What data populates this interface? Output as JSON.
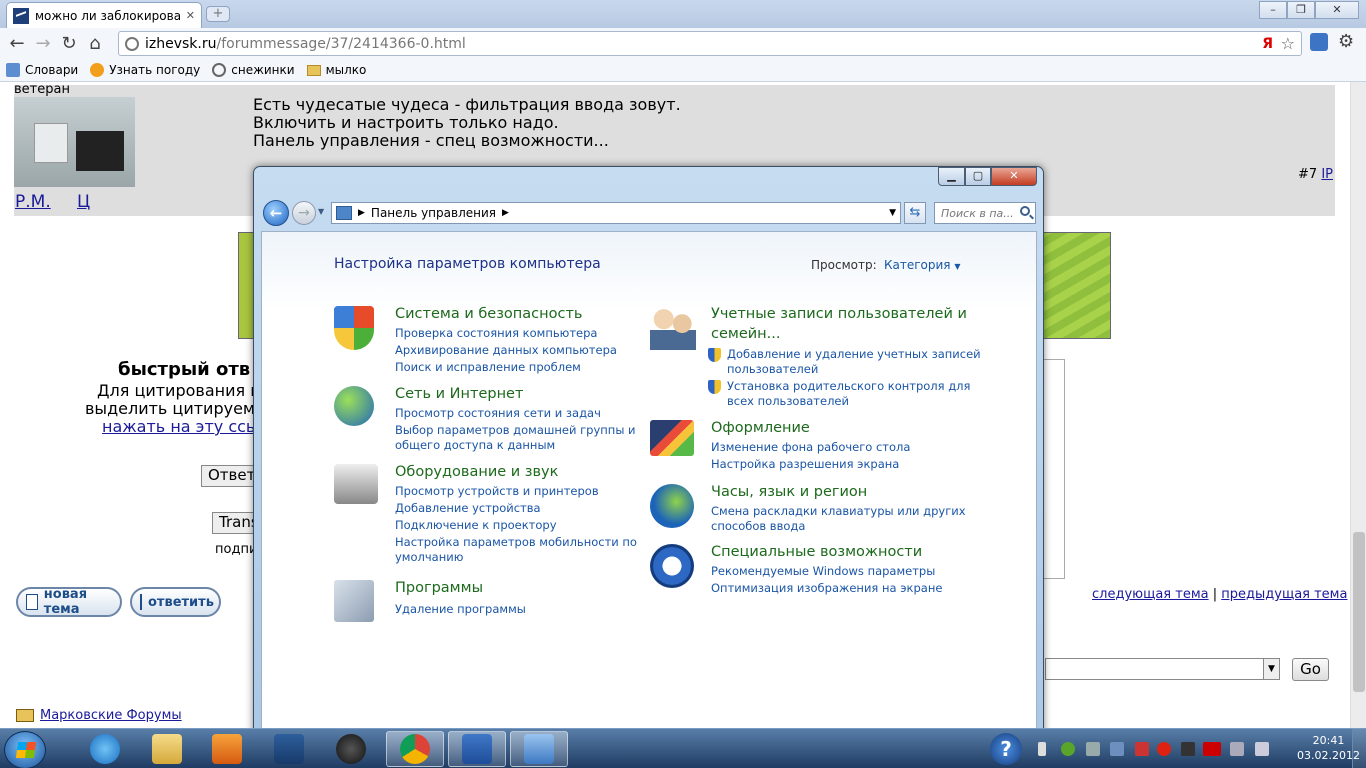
{
  "browser": {
    "tab_title": "можно ли заблокировать",
    "url_host": "izhevsk.ru",
    "url_path": "/forummessage/37/2414366-0.html",
    "bookmarks": [
      "Словари",
      "Узнать погоду",
      "снежинки",
      "мылко"
    ]
  },
  "page": {
    "user_status": "ветеран",
    "post_lines": [
      "Есть чудесатые чудеса - фильтрация ввода зовут.",
      "Включить и настроить только надо.",
      "Панель управления - спец возможности..."
    ],
    "user_link": "Р.М.",
    "user_link2": "Ц",
    "post_number": "#7",
    "ip_link": "IP",
    "quick_reply_title": "быстрый отв",
    "quote_lines": [
      "Для цитирования н",
      "выделить цитируемо",
      "нажать на эту ссы"
    ],
    "reply_button": "Ответ",
    "translit_button": "Trans",
    "sign_label": "подпи",
    "new_topic_button": "новая тема",
    "answer_button": "ответить",
    "next_topic": "следующая тема",
    "separator": "|",
    "prev_topic": "предыдущая тема",
    "go_button": "Go",
    "forums_link": "Марковские Форумы"
  },
  "control_panel": {
    "breadcrumb": "Панель управления",
    "search_placeholder": "Поиск в па...",
    "heading": "Настройка параметров компьютера",
    "view_label": "Просмотр:",
    "view_value": "Категория",
    "categories_left": [
      {
        "title": "Система и безопасность",
        "links": [
          "Проверка состояния компьютера",
          "Архивирование данных компьютера",
          "Поиск и исправление проблем"
        ]
      },
      {
        "title": "Сеть и Интернет",
        "links": [
          "Просмотр состояния сети и задач",
          "Выбор параметров домашней группы и",
          "общего доступа к данным"
        ]
      },
      {
        "title": "Оборудование и звук",
        "links": [
          "Просмотр устройств и принтеров",
          "Добавление устройства",
          "Подключение к проектору",
          "Настройка параметров мобильности по",
          "умолчанию"
        ]
      },
      {
        "title": "Программы",
        "links": [
          "Удаление программы"
        ]
      }
    ],
    "categories_right": [
      {
        "title_lines": [
          "Учетные записи пользователей и",
          "семейн..."
        ],
        "links": [
          "Добавление и удаление учетных записей",
          "пользователей",
          "Установка родительского контроля для",
          "всех пользователей"
        ]
      },
      {
        "title": "Оформление",
        "links": [
          "Изменение фона рабочего стола",
          "Настройка разрешения экрана"
        ]
      },
      {
        "title": "Часы, язык и регион",
        "links": [
          "Смена раскладки клавиатуры или других",
          "способов ввода"
        ]
      },
      {
        "title": "Специальные возможности",
        "links": [
          "Рекомендуемые Windows параметры",
          "Оптимизация изображения на экране"
        ]
      }
    ]
  },
  "taskbar": {
    "time": "20:41",
    "date": "03.02.2012"
  },
  "icons": {
    "back": "back-arrow-icon",
    "forward": "forward-arrow-icon",
    "refresh": "refresh-icon",
    "home": "home-icon",
    "star": "bookmark-star-icon",
    "search": "search-icon"
  }
}
